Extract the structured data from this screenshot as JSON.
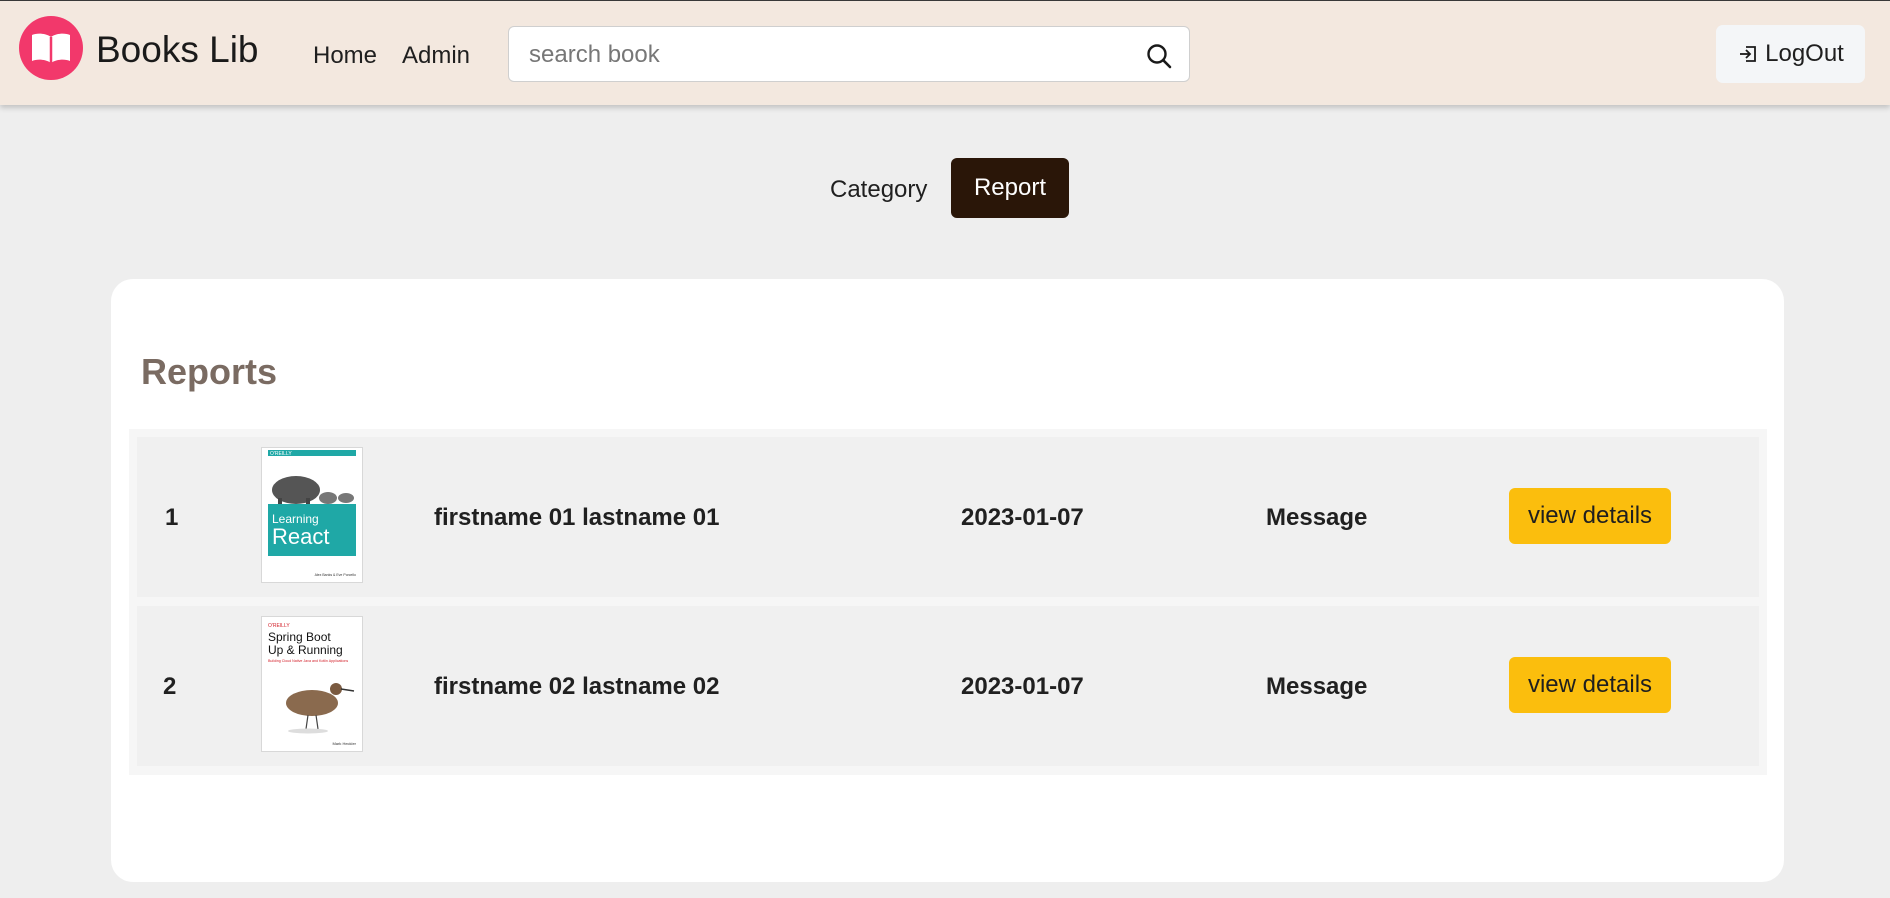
{
  "header": {
    "brand": "Books Lib",
    "nav": [
      "Home",
      "Admin"
    ],
    "search_placeholder": "search book",
    "logout_label": "LogOut"
  },
  "tabs": {
    "category": "Category",
    "report": "Report"
  },
  "reports": {
    "title": "Reports",
    "rows": [
      {
        "index": "1",
        "name": "firstname 01 lastname 01",
        "date": "2023-01-07",
        "type": "Message",
        "action": "view details",
        "cover": {
          "publisher": "O'REILLY",
          "title_line1": "Learning",
          "title_line2": "React",
          "authors": "Alex Banks & Eve Porcello"
        }
      },
      {
        "index": "2",
        "name": "firstname 02 lastname 02",
        "date": "2023-01-07",
        "type": "Message",
        "action": "view details",
        "cover": {
          "publisher": "O'REILLY",
          "title_line1": "Spring Boot",
          "title_line2": "Up & Running",
          "subtitle": "Building Cloud Native Java and Kotlin Applications",
          "authors": "Mark Heckler"
        }
      }
    ]
  },
  "colors": {
    "header_bg": "#f3e8df",
    "logo": "#f2386b",
    "active_tab": "#2a1608",
    "button": "#fbbe0d",
    "title": "#7a6b62",
    "react_cover": "#1fa8a6"
  }
}
